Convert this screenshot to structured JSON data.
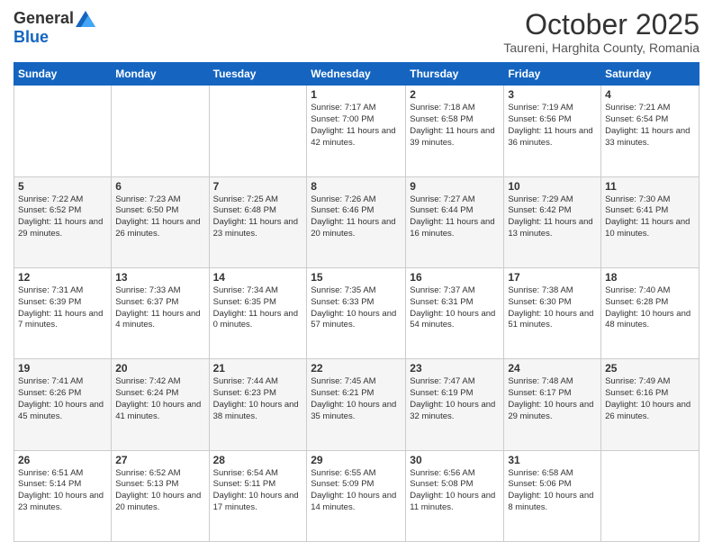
{
  "header": {
    "logo_general": "General",
    "logo_blue": "Blue",
    "month": "October 2025",
    "location": "Taureni, Harghita County, Romania"
  },
  "days_of_week": [
    "Sunday",
    "Monday",
    "Tuesday",
    "Wednesday",
    "Thursday",
    "Friday",
    "Saturday"
  ],
  "weeks": [
    [
      {
        "day": "",
        "info": ""
      },
      {
        "day": "",
        "info": ""
      },
      {
        "day": "",
        "info": ""
      },
      {
        "day": "1",
        "info": "Sunrise: 7:17 AM\nSunset: 7:00 PM\nDaylight: 11 hours and 42 minutes."
      },
      {
        "day": "2",
        "info": "Sunrise: 7:18 AM\nSunset: 6:58 PM\nDaylight: 11 hours and 39 minutes."
      },
      {
        "day": "3",
        "info": "Sunrise: 7:19 AM\nSunset: 6:56 PM\nDaylight: 11 hours and 36 minutes."
      },
      {
        "day": "4",
        "info": "Sunrise: 7:21 AM\nSunset: 6:54 PM\nDaylight: 11 hours and 33 minutes."
      }
    ],
    [
      {
        "day": "5",
        "info": "Sunrise: 7:22 AM\nSunset: 6:52 PM\nDaylight: 11 hours and 29 minutes."
      },
      {
        "day": "6",
        "info": "Sunrise: 7:23 AM\nSunset: 6:50 PM\nDaylight: 11 hours and 26 minutes."
      },
      {
        "day": "7",
        "info": "Sunrise: 7:25 AM\nSunset: 6:48 PM\nDaylight: 11 hours and 23 minutes."
      },
      {
        "day": "8",
        "info": "Sunrise: 7:26 AM\nSunset: 6:46 PM\nDaylight: 11 hours and 20 minutes."
      },
      {
        "day": "9",
        "info": "Sunrise: 7:27 AM\nSunset: 6:44 PM\nDaylight: 11 hours and 16 minutes."
      },
      {
        "day": "10",
        "info": "Sunrise: 7:29 AM\nSunset: 6:42 PM\nDaylight: 11 hours and 13 minutes."
      },
      {
        "day": "11",
        "info": "Sunrise: 7:30 AM\nSunset: 6:41 PM\nDaylight: 11 hours and 10 minutes."
      }
    ],
    [
      {
        "day": "12",
        "info": "Sunrise: 7:31 AM\nSunset: 6:39 PM\nDaylight: 11 hours and 7 minutes."
      },
      {
        "day": "13",
        "info": "Sunrise: 7:33 AM\nSunset: 6:37 PM\nDaylight: 11 hours and 4 minutes."
      },
      {
        "day": "14",
        "info": "Sunrise: 7:34 AM\nSunset: 6:35 PM\nDaylight: 11 hours and 0 minutes."
      },
      {
        "day": "15",
        "info": "Sunrise: 7:35 AM\nSunset: 6:33 PM\nDaylight: 10 hours and 57 minutes."
      },
      {
        "day": "16",
        "info": "Sunrise: 7:37 AM\nSunset: 6:31 PM\nDaylight: 10 hours and 54 minutes."
      },
      {
        "day": "17",
        "info": "Sunrise: 7:38 AM\nSunset: 6:30 PM\nDaylight: 10 hours and 51 minutes."
      },
      {
        "day": "18",
        "info": "Sunrise: 7:40 AM\nSunset: 6:28 PM\nDaylight: 10 hours and 48 minutes."
      }
    ],
    [
      {
        "day": "19",
        "info": "Sunrise: 7:41 AM\nSunset: 6:26 PM\nDaylight: 10 hours and 45 minutes."
      },
      {
        "day": "20",
        "info": "Sunrise: 7:42 AM\nSunset: 6:24 PM\nDaylight: 10 hours and 41 minutes."
      },
      {
        "day": "21",
        "info": "Sunrise: 7:44 AM\nSunset: 6:23 PM\nDaylight: 10 hours and 38 minutes."
      },
      {
        "day": "22",
        "info": "Sunrise: 7:45 AM\nSunset: 6:21 PM\nDaylight: 10 hours and 35 minutes."
      },
      {
        "day": "23",
        "info": "Sunrise: 7:47 AM\nSunset: 6:19 PM\nDaylight: 10 hours and 32 minutes."
      },
      {
        "day": "24",
        "info": "Sunrise: 7:48 AM\nSunset: 6:17 PM\nDaylight: 10 hours and 29 minutes."
      },
      {
        "day": "25",
        "info": "Sunrise: 7:49 AM\nSunset: 6:16 PM\nDaylight: 10 hours and 26 minutes."
      }
    ],
    [
      {
        "day": "26",
        "info": "Sunrise: 6:51 AM\nSunset: 5:14 PM\nDaylight: 10 hours and 23 minutes."
      },
      {
        "day": "27",
        "info": "Sunrise: 6:52 AM\nSunset: 5:13 PM\nDaylight: 10 hours and 20 minutes."
      },
      {
        "day": "28",
        "info": "Sunrise: 6:54 AM\nSunset: 5:11 PM\nDaylight: 10 hours and 17 minutes."
      },
      {
        "day": "29",
        "info": "Sunrise: 6:55 AM\nSunset: 5:09 PM\nDaylight: 10 hours and 14 minutes."
      },
      {
        "day": "30",
        "info": "Sunrise: 6:56 AM\nSunset: 5:08 PM\nDaylight: 10 hours and 11 minutes."
      },
      {
        "day": "31",
        "info": "Sunrise: 6:58 AM\nSunset: 5:06 PM\nDaylight: 10 hours and 8 minutes."
      },
      {
        "day": "",
        "info": ""
      }
    ]
  ]
}
